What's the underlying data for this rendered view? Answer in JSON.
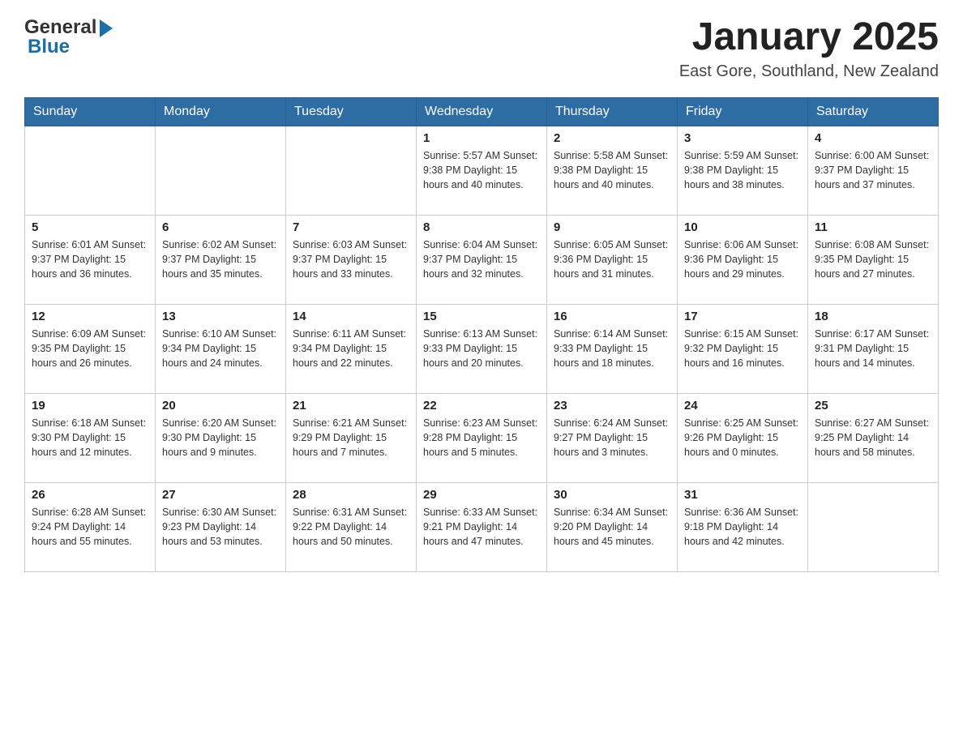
{
  "header": {
    "logo_general": "General",
    "logo_blue": "Blue",
    "title": "January 2025",
    "subtitle": "East Gore, Southland, New Zealand"
  },
  "days_of_week": [
    "Sunday",
    "Monday",
    "Tuesday",
    "Wednesday",
    "Thursday",
    "Friday",
    "Saturday"
  ],
  "weeks": [
    [
      {
        "day": "",
        "info": ""
      },
      {
        "day": "",
        "info": ""
      },
      {
        "day": "",
        "info": ""
      },
      {
        "day": "1",
        "info": "Sunrise: 5:57 AM\nSunset: 9:38 PM\nDaylight: 15 hours and 40 minutes."
      },
      {
        "day": "2",
        "info": "Sunrise: 5:58 AM\nSunset: 9:38 PM\nDaylight: 15 hours and 40 minutes."
      },
      {
        "day": "3",
        "info": "Sunrise: 5:59 AM\nSunset: 9:38 PM\nDaylight: 15 hours and 38 minutes."
      },
      {
        "day": "4",
        "info": "Sunrise: 6:00 AM\nSunset: 9:37 PM\nDaylight: 15 hours and 37 minutes."
      }
    ],
    [
      {
        "day": "5",
        "info": "Sunrise: 6:01 AM\nSunset: 9:37 PM\nDaylight: 15 hours and 36 minutes."
      },
      {
        "day": "6",
        "info": "Sunrise: 6:02 AM\nSunset: 9:37 PM\nDaylight: 15 hours and 35 minutes."
      },
      {
        "day": "7",
        "info": "Sunrise: 6:03 AM\nSunset: 9:37 PM\nDaylight: 15 hours and 33 minutes."
      },
      {
        "day": "8",
        "info": "Sunrise: 6:04 AM\nSunset: 9:37 PM\nDaylight: 15 hours and 32 minutes."
      },
      {
        "day": "9",
        "info": "Sunrise: 6:05 AM\nSunset: 9:36 PM\nDaylight: 15 hours and 31 minutes."
      },
      {
        "day": "10",
        "info": "Sunrise: 6:06 AM\nSunset: 9:36 PM\nDaylight: 15 hours and 29 minutes."
      },
      {
        "day": "11",
        "info": "Sunrise: 6:08 AM\nSunset: 9:35 PM\nDaylight: 15 hours and 27 minutes."
      }
    ],
    [
      {
        "day": "12",
        "info": "Sunrise: 6:09 AM\nSunset: 9:35 PM\nDaylight: 15 hours and 26 minutes."
      },
      {
        "day": "13",
        "info": "Sunrise: 6:10 AM\nSunset: 9:34 PM\nDaylight: 15 hours and 24 minutes."
      },
      {
        "day": "14",
        "info": "Sunrise: 6:11 AM\nSunset: 9:34 PM\nDaylight: 15 hours and 22 minutes."
      },
      {
        "day": "15",
        "info": "Sunrise: 6:13 AM\nSunset: 9:33 PM\nDaylight: 15 hours and 20 minutes."
      },
      {
        "day": "16",
        "info": "Sunrise: 6:14 AM\nSunset: 9:33 PM\nDaylight: 15 hours and 18 minutes."
      },
      {
        "day": "17",
        "info": "Sunrise: 6:15 AM\nSunset: 9:32 PM\nDaylight: 15 hours and 16 minutes."
      },
      {
        "day": "18",
        "info": "Sunrise: 6:17 AM\nSunset: 9:31 PM\nDaylight: 15 hours and 14 minutes."
      }
    ],
    [
      {
        "day": "19",
        "info": "Sunrise: 6:18 AM\nSunset: 9:30 PM\nDaylight: 15 hours and 12 minutes."
      },
      {
        "day": "20",
        "info": "Sunrise: 6:20 AM\nSunset: 9:30 PM\nDaylight: 15 hours and 9 minutes."
      },
      {
        "day": "21",
        "info": "Sunrise: 6:21 AM\nSunset: 9:29 PM\nDaylight: 15 hours and 7 minutes."
      },
      {
        "day": "22",
        "info": "Sunrise: 6:23 AM\nSunset: 9:28 PM\nDaylight: 15 hours and 5 minutes."
      },
      {
        "day": "23",
        "info": "Sunrise: 6:24 AM\nSunset: 9:27 PM\nDaylight: 15 hours and 3 minutes."
      },
      {
        "day": "24",
        "info": "Sunrise: 6:25 AM\nSunset: 9:26 PM\nDaylight: 15 hours and 0 minutes."
      },
      {
        "day": "25",
        "info": "Sunrise: 6:27 AM\nSunset: 9:25 PM\nDaylight: 14 hours and 58 minutes."
      }
    ],
    [
      {
        "day": "26",
        "info": "Sunrise: 6:28 AM\nSunset: 9:24 PM\nDaylight: 14 hours and 55 minutes."
      },
      {
        "day": "27",
        "info": "Sunrise: 6:30 AM\nSunset: 9:23 PM\nDaylight: 14 hours and 53 minutes."
      },
      {
        "day": "28",
        "info": "Sunrise: 6:31 AM\nSunset: 9:22 PM\nDaylight: 14 hours and 50 minutes."
      },
      {
        "day": "29",
        "info": "Sunrise: 6:33 AM\nSunset: 9:21 PM\nDaylight: 14 hours and 47 minutes."
      },
      {
        "day": "30",
        "info": "Sunrise: 6:34 AM\nSunset: 9:20 PM\nDaylight: 14 hours and 45 minutes."
      },
      {
        "day": "31",
        "info": "Sunrise: 6:36 AM\nSunset: 9:18 PM\nDaylight: 14 hours and 42 minutes."
      },
      {
        "day": "",
        "info": ""
      }
    ]
  ]
}
